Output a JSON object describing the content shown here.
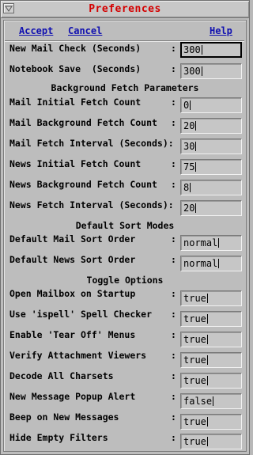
{
  "window": {
    "title": "Preferences",
    "menu_icon": "window-menu-icon"
  },
  "actions": {
    "accept": "Accept",
    "cancel": "Cancel",
    "help": "Help"
  },
  "general": [
    {
      "label": "New Mail Check (Seconds)",
      "value": "300"
    },
    {
      "label": "Notebook Save  (Seconds)",
      "value": "300"
    }
  ],
  "sections": {
    "background_fetch": {
      "heading": "Background Fetch Parameters",
      "rows": [
        {
          "label": "Mail Initial Fetch Count",
          "value": "0"
        },
        {
          "label": "Mail Background Fetch Count",
          "value": "20"
        },
        {
          "label": "Mail Fetch Interval (Seconds):",
          "value": "30"
        },
        {
          "label": "News Initial Fetch Count",
          "value": "75"
        },
        {
          "label": "News Background Fetch Count",
          "value": "8"
        },
        {
          "label": "News Fetch Interval (Seconds):",
          "value": "20"
        }
      ]
    },
    "sort_modes": {
      "heading": "Default Sort Modes",
      "rows": [
        {
          "label": "Default Mail Sort Order",
          "value": "normal"
        },
        {
          "label": "Default News Sort Order",
          "value": "normal"
        }
      ]
    },
    "toggles": {
      "heading": "Toggle Options",
      "rows": [
        {
          "label": "Open Mailbox on Startup",
          "value": "true"
        },
        {
          "label": "Use 'ispell' Spell Checker",
          "value": "true"
        },
        {
          "label": "Enable 'Tear Off' Menus",
          "value": "true"
        },
        {
          "label": "Verify Attachment Viewers",
          "value": "true"
        },
        {
          "label": "Decode All Charsets",
          "value": "true"
        },
        {
          "label": "New Message Popup Alert",
          "value": "false"
        },
        {
          "label": "Beep on New Messages",
          "value": "true"
        },
        {
          "label": "Hide Empty Filters",
          "value": "true"
        }
      ]
    }
  },
  "colon": ":",
  "colors": {
    "title": "#d40000",
    "action_links": "#1010b0",
    "background": "#bdbdbd"
  }
}
